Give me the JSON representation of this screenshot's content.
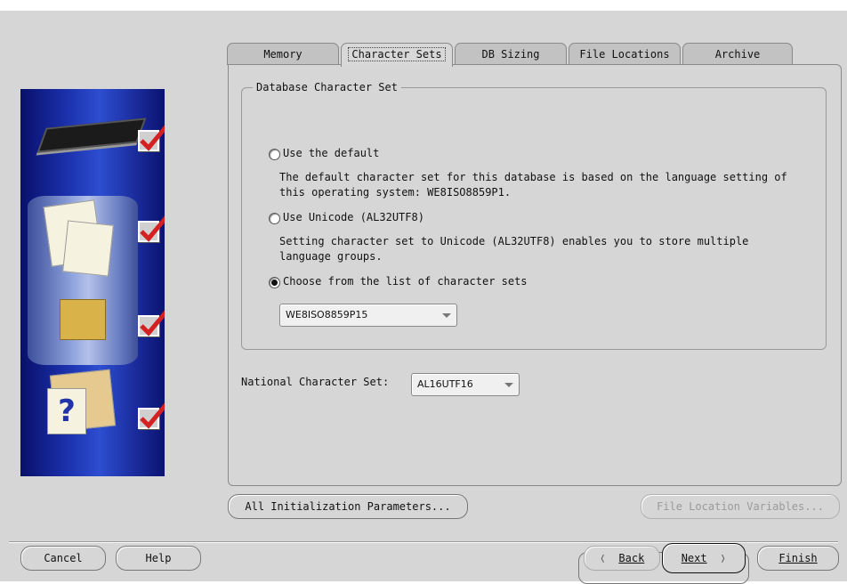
{
  "tabs": [
    {
      "label": "Memory"
    },
    {
      "label": "Character Sets",
      "active": true
    },
    {
      "label": "DB Sizing"
    },
    {
      "label": "File Locations"
    },
    {
      "label": "Archive"
    }
  ],
  "database_charset": {
    "group_label": "Database Character Set",
    "options": [
      {
        "label": "Use the default",
        "selected": false,
        "description": "The default character set for this database is based on the language setting of this operating system: WE8ISO8859P1."
      },
      {
        "label": "Use Unicode (AL32UTF8)",
        "selected": false,
        "description": "Setting character set to Unicode (AL32UTF8) enables you to store multiple language groups."
      },
      {
        "label": "Choose from the list of character sets",
        "selected": true
      }
    ],
    "charset_select_value": "WE8ISO8859P15"
  },
  "national_charset": {
    "label": "National Character Set:",
    "value": "AL16UTF16"
  },
  "buttons": {
    "all_init_params": "All Initialization Parameters...",
    "file_location_vars": "File Location Variables...",
    "cancel": "Cancel",
    "help": "Help",
    "back": "Back",
    "next": "Next",
    "finish": "Finish"
  },
  "side_panel": {
    "steps": [
      {
        "icon": "memory-chip-icon",
        "checked": true
      },
      {
        "icon": "database-documents-icon",
        "checked": true
      },
      {
        "icon": "shapes-icon",
        "checked": true
      },
      {
        "icon": "folders-help-icon",
        "checked": true
      }
    ],
    "check_color": "#d42020"
  }
}
